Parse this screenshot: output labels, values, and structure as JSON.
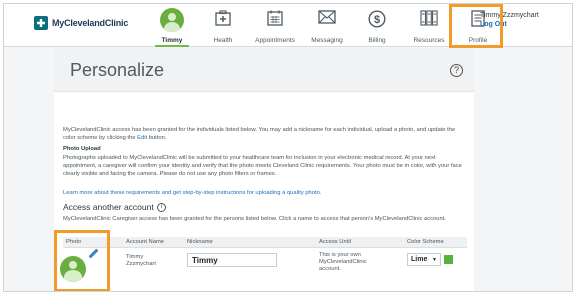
{
  "brand": {
    "name": "MyClevelandClinic"
  },
  "nav": [
    {
      "label": "Timmy",
      "icon": "user-avatar-icon",
      "active": true
    },
    {
      "label": "Health",
      "icon": "medical-kit-icon"
    },
    {
      "label": "Appointments",
      "icon": "calendar-icon"
    },
    {
      "label": "Messaging",
      "icon": "envelope-icon"
    },
    {
      "label": "Billing",
      "icon": "dollar-circle-icon"
    },
    {
      "label": "Resources",
      "icon": "books-icon"
    },
    {
      "label": "Profile",
      "icon": "profile-document-icon"
    }
  ],
  "user": {
    "name": "Timmy Zzzmychart",
    "logout": "Log Out"
  },
  "page": {
    "title": "Personalize",
    "intro_pre": "MyClevelandClinic access has been granted for the individuals listed below. You may add a nickname for each individual, upload a photo, and update the color scheme by clicking the ",
    "intro_bold": "Edit",
    "intro_post": " button.",
    "upload_heading": "Photo Upload",
    "upload_text": "Photographs uploaded to MyClevelandClinic will be submitted to your healthcare team for inclusion in your electronic medical record. At your next appointment, a caregiver will confirm your identity and verify that the photo meets Cleveland Clinic requirements. Your photo must be in color, with your face clearly visible and facing the camera. Please do not use any photo filters or frames.",
    "learn_link": "Learn more about these requirements and get step-by-step instructions for uploading a quality photo.",
    "access_heading": "Access another account",
    "access_text": "MyClevelandClinic Caregiver access has been granted for the persons listed below.  Click a name to access that person's MyClevelandClinic account."
  },
  "table": {
    "headers": {
      "photo": "Photo",
      "account": "Account Name",
      "nickname": "Nickname",
      "until": "Access Until",
      "scheme": "Color Scheme"
    },
    "row": {
      "account_line1": "Timmy",
      "account_line2": "Zzzmychart",
      "nickname": "Timmy",
      "until_line1": "This is your own",
      "until_line2": "MyClevelandClinic",
      "until_line3": "account.",
      "scheme": "Lime",
      "scheme_color": "#56b33b"
    }
  },
  "colors": {
    "highlight": "#f29a2a",
    "accent": "#74b84a",
    "link": "#1f6fb4"
  }
}
